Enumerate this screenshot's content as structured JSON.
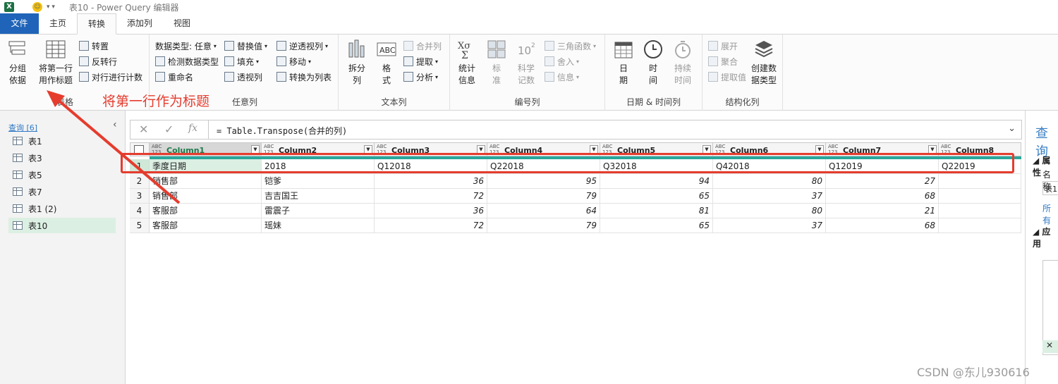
{
  "title_bar": {
    "title": "表10 - Power Query 编辑器"
  },
  "menu": {
    "tabs": [
      "文件",
      "主页",
      "转换",
      "添加列",
      "视图"
    ]
  },
  "ribbon": {
    "table_group": {
      "label": "表格",
      "group_by": "分组\n依据",
      "use_first_row": "将第一行\n用作标题",
      "transpose": "转置",
      "reverse_rows": "反转行",
      "count_rows": "对行进行计数"
    },
    "any_column_group": {
      "label": "任意列",
      "data_type": "数据类型: 任意",
      "detect_type": "检测数据类型",
      "rename": "重命名",
      "replace_values": "替换值",
      "fill": "填充",
      "pivot": "透视列",
      "unpivot": "逆透视列",
      "move": "移动",
      "to_list": "转换为列表"
    },
    "text_column_group": {
      "label": "文本列",
      "split": "拆分\n列",
      "format": "格\n式",
      "merge": "合并列",
      "extract": "提取",
      "parse": "分析"
    },
    "number_column_group": {
      "label": "编号列",
      "statistics": "统计\n信息",
      "standard": "标\n准",
      "scientific": "科学\n记数",
      "trig": "三角函数",
      "rounding": "舍入",
      "info": "信息"
    },
    "datetime_group": {
      "label": "日期 & 时间列",
      "date": "日\n期",
      "time": "时\n间",
      "duration": "持续\n时间"
    },
    "structured_group": {
      "label": "结构化列",
      "expand": "展开",
      "aggregate": "聚合",
      "extract_values": "提取值",
      "create_type": "创建数\n据类型"
    }
  },
  "queries": {
    "header": "查询 [6]",
    "items": [
      {
        "label": "表1",
        "selected": false
      },
      {
        "label": "表3",
        "selected": false
      },
      {
        "label": "表5",
        "selected": false
      },
      {
        "label": "表7",
        "selected": false
      },
      {
        "label": "表1 (2)",
        "selected": false
      },
      {
        "label": "表10",
        "selected": true
      }
    ]
  },
  "formula_bar": {
    "formula": "= Table.Transpose(合并的列)",
    "fx_label": "fx"
  },
  "table": {
    "type_label": "ABC\n123",
    "columns": [
      "Column1",
      "Column2",
      "Column3",
      "Column4",
      "Column5",
      "Column6",
      "Column7",
      "Column8"
    ],
    "rows": [
      {
        "n": "1",
        "cells": [
          "季度日期",
          "2018",
          "Q12018",
          "Q22018",
          "Q32018",
          "Q42018",
          "Q12019",
          "Q22019"
        ]
      },
      {
        "n": "2",
        "cells": [
          "销售部",
          "铠爹",
          "36",
          "95",
          "94",
          "80",
          "27",
          ""
        ]
      },
      {
        "n": "3",
        "cells": [
          "销售部",
          "吉吉国王",
          "72",
          "79",
          "65",
          "37",
          "68",
          ""
        ]
      },
      {
        "n": "4",
        "cells": [
          "客服部",
          "雷震子",
          "36",
          "64",
          "81",
          "80",
          "21",
          ""
        ]
      },
      {
        "n": "5",
        "cells": [
          "客服部",
          "瑶妹",
          "72",
          "79",
          "65",
          "37",
          "68",
          ""
        ]
      }
    ]
  },
  "right_pane": {
    "title": "查询",
    "properties": "属性",
    "name_label": "名称",
    "name_value": "表1",
    "all_props": "所有",
    "applied": "应用"
  },
  "annotation": {
    "text": "将第一行作为标题"
  },
  "watermark": "CSDN @东儿930616",
  "colors": {
    "accent_blue": "#1f64b8",
    "quality_bar": "#27a79b",
    "annotation_red": "#e53c2e",
    "selected_green": "#dcefe3"
  }
}
